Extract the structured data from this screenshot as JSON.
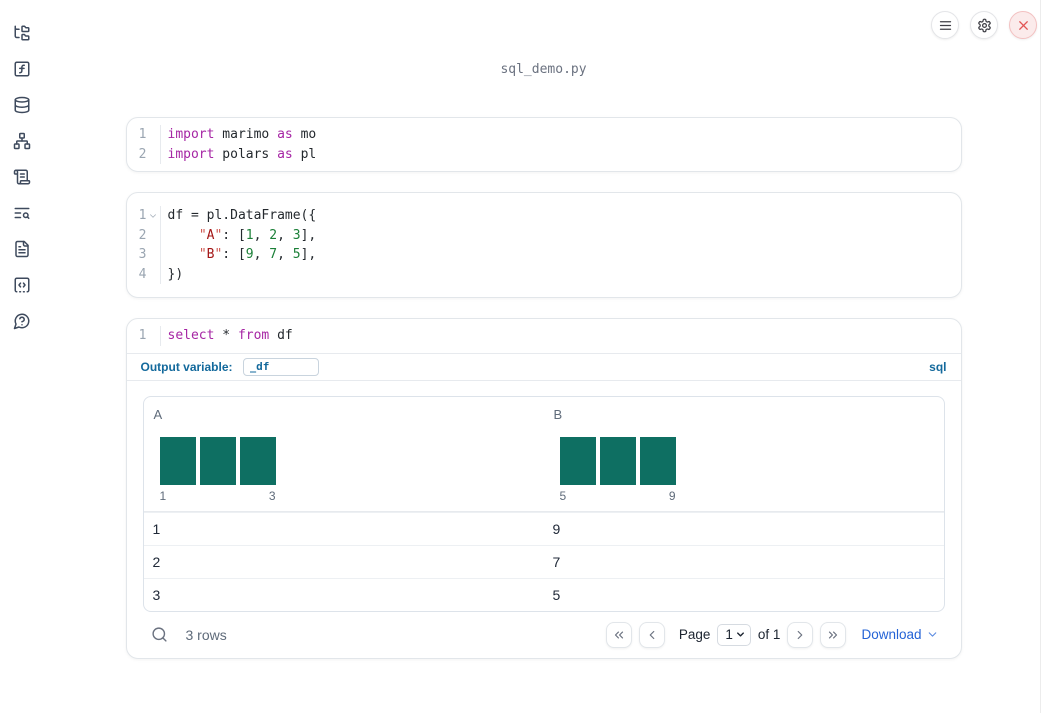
{
  "window": {
    "title": "sql_demo.py"
  },
  "header": {
    "buttons": [
      {
        "icon": "menu-icon",
        "name": "notebook-menu-button"
      },
      {
        "icon": "gear-icon",
        "name": "settings-button"
      },
      {
        "icon": "close-icon",
        "name": "shutdown-button",
        "variant": "danger"
      }
    ]
  },
  "sidebar": {
    "items": [
      {
        "icon": "folder-tree-icon",
        "name": "sidebar-item-file-explorer"
      },
      {
        "icon": "function-square-icon",
        "name": "sidebar-item-variables"
      },
      {
        "icon": "database-icon",
        "name": "sidebar-item-data-sources"
      },
      {
        "icon": "network-icon",
        "name": "sidebar-item-dependencies"
      },
      {
        "icon": "scroll-text-icon",
        "name": "sidebar-item-outline"
      },
      {
        "icon": "text-search-icon",
        "name": "sidebar-item-logs"
      },
      {
        "icon": "file-text-icon",
        "name": "sidebar-item-documentation"
      },
      {
        "icon": "code-square-dashed-icon",
        "name": "sidebar-item-snippets"
      },
      {
        "icon": "help-bubble-icon",
        "name": "sidebar-item-help"
      }
    ]
  },
  "colors": {
    "bar_teal": "#0e6f62",
    "accent_blue": "#13699c",
    "link_blue": "#2463d6",
    "keyword_purple": "#a626a4",
    "string_red": "#a31515",
    "number_green": "#1a7f37"
  },
  "cells": [
    {
      "kind": "python",
      "name": "code-cell-imports",
      "lines": [
        {
          "num": "1",
          "tokens": [
            [
              "kw",
              "import"
            ],
            [
              "pl",
              " marimo "
            ],
            [
              "kw",
              "as"
            ],
            [
              "pl",
              " mo"
            ]
          ]
        },
        {
          "num": "2",
          "tokens": [
            [
              "kw",
              "import"
            ],
            [
              "pl",
              " polars "
            ],
            [
              "kw",
              "as"
            ],
            [
              "pl",
              " pl"
            ]
          ]
        }
      ]
    },
    {
      "kind": "python",
      "name": "code-cell-dataframe",
      "lines": [
        {
          "num": "1",
          "fold": true,
          "tokens": [
            [
              "pl",
              "df = pl.DataFrame({"
            ]
          ]
        },
        {
          "num": "2",
          "tokens": [
            [
              "pl",
              "    "
            ],
            [
              "q",
              "\""
            ],
            [
              "st",
              "A"
            ],
            [
              "q",
              "\""
            ],
            [
              "pl",
              ": ["
            ],
            [
              "nu",
              "1"
            ],
            [
              "pl",
              ", "
            ],
            [
              "nu",
              "2"
            ],
            [
              "pl",
              ", "
            ],
            [
              "nu",
              "3"
            ],
            [
              "pl",
              "],"
            ]
          ]
        },
        {
          "num": "3",
          "tokens": [
            [
              "pl",
              "    "
            ],
            [
              "q",
              "\""
            ],
            [
              "st",
              "B"
            ],
            [
              "q",
              "\""
            ],
            [
              "pl",
              ": ["
            ],
            [
              "nu",
              "9"
            ],
            [
              "pl",
              ", "
            ],
            [
              "nu",
              "7"
            ],
            [
              "pl",
              ", "
            ],
            [
              "nu",
              "5"
            ],
            [
              "pl",
              "],"
            ]
          ]
        },
        {
          "num": "4",
          "tokens": [
            [
              "pl",
              "})"
            ]
          ]
        }
      ]
    },
    {
      "kind": "sql",
      "name": "sql-cell",
      "lines": [
        {
          "num": "1",
          "tokens": [
            [
              "kw",
              "select"
            ],
            [
              "pl",
              " * "
            ],
            [
              "kw",
              "from"
            ],
            [
              "pl",
              " df"
            ]
          ]
        }
      ],
      "output_variable_label": "Output variable:",
      "output_variable_value": "_df",
      "language_badge": "sql"
    }
  ],
  "table": {
    "columns": [
      {
        "name": "A",
        "histogram": {
          "values": [
            1,
            1,
            1
          ],
          "min_label": "1",
          "max_label": "3"
        }
      },
      {
        "name": "B",
        "histogram": {
          "values": [
            1,
            1,
            1
          ],
          "min_label": "5",
          "max_label": "9"
        }
      }
    ],
    "rows": [
      [
        "1",
        "9"
      ],
      [
        "2",
        "7"
      ],
      [
        "3",
        "5"
      ]
    ],
    "footer": {
      "row_count": "3 rows",
      "page_label": "Page",
      "page_value": "1",
      "page_total": "of 1",
      "download_label": "Download"
    }
  }
}
